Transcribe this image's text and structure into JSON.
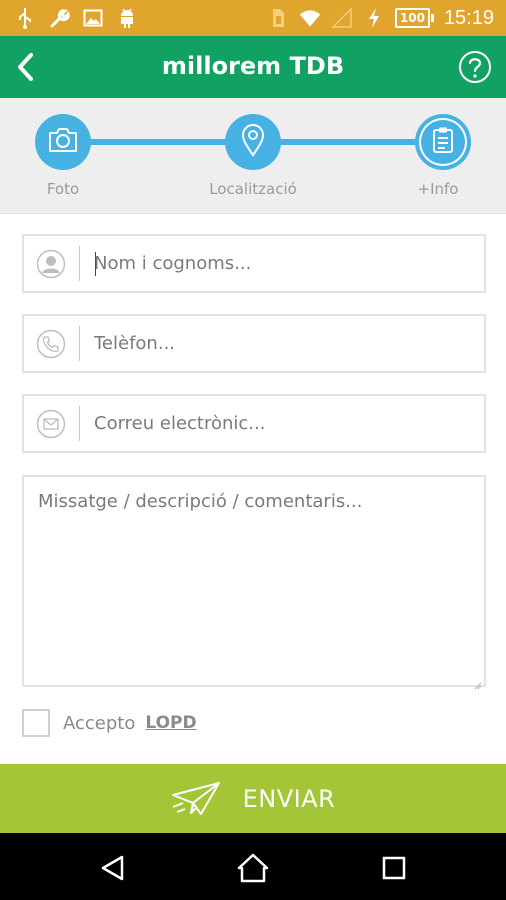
{
  "status_bar": {
    "battery": "100",
    "time": "15:19",
    "icons": [
      "usb-icon",
      "wrench-icon",
      "image-icon",
      "android-icon",
      "sim-icon",
      "wifi-icon",
      "signal-icon",
      "charging-icon",
      "battery-icon"
    ]
  },
  "app_bar": {
    "title": "millorem TDB",
    "icons": [
      "back-chevron-icon",
      "help-icon"
    ]
  },
  "steps": [
    {
      "label": "Foto",
      "icon": "camera-icon"
    },
    {
      "label": "Localització",
      "icon": "location-pin-icon"
    },
    {
      "label": "+Info",
      "icon": "clipboard-icon",
      "active": true
    }
  ],
  "form": {
    "name_placeholder": "Nom i cognoms...",
    "phone_placeholder": "Telèfon...",
    "email_placeholder": "Correu electrònic...",
    "message_placeholder": "Missatge / descripció / comentaris...",
    "accept_label": "Accepto",
    "lopd_link": "LOPD"
  },
  "send_button": {
    "label": "ENVIAR",
    "icon": "paper-plane-icon"
  },
  "nav_bar": {
    "icons": [
      "back-triangle-icon",
      "home-icon",
      "recents-icon"
    ]
  },
  "colors": {
    "status_bar": "#e0a52c",
    "app_bar": "#10a163",
    "step_blue": "#45b2e3",
    "send_green": "#a3c536"
  }
}
